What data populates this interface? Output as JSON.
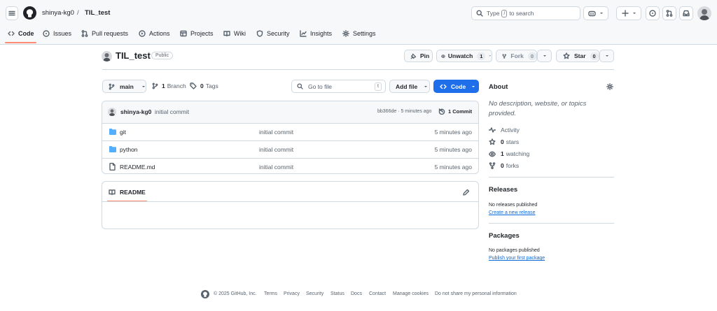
{
  "header": {
    "owner": "shinya-kg0",
    "separator": "/",
    "repo": "TIL_test",
    "search_prefix": "Type",
    "search_key": "/",
    "search_suffix": "to search",
    "tabs": [
      {
        "label": "Code",
        "icon": "code-icon",
        "selected": true
      },
      {
        "label": "Issues",
        "icon": "issue-icon"
      },
      {
        "label": "Pull requests",
        "icon": "pull-request-icon"
      },
      {
        "label": "Actions",
        "icon": "play-icon"
      },
      {
        "label": "Projects",
        "icon": "table-icon"
      },
      {
        "label": "Wiki",
        "icon": "book-icon"
      },
      {
        "label": "Security",
        "icon": "shield-icon"
      },
      {
        "label": "Insights",
        "icon": "graph-icon"
      },
      {
        "label": "Settings",
        "icon": "gear-icon"
      }
    ]
  },
  "repo": {
    "name": "TIL_test",
    "visibility": "Public",
    "pin_label": "Pin",
    "unwatch_label": "Unwatch",
    "watch_count": "1",
    "fork_label": "Fork",
    "fork_count": "0",
    "star_label": "Star",
    "star_count": "0"
  },
  "toolbar": {
    "branch": "main",
    "branch_count": "1",
    "branch_label": "Branch",
    "tag_count": "0",
    "tag_label": "Tags",
    "goto_placeholder": "Go to file",
    "goto_key": "t",
    "add_file_label": "Add file",
    "code_label": "Code"
  },
  "commit": {
    "author": "shinya-kg0",
    "message": "initial commit",
    "meta": "bb366de · 5 minutes ago",
    "count_label": "1 Commit"
  },
  "files": [
    {
      "name": "git",
      "type": "folder",
      "message": "initial commit",
      "date": "5 minutes ago"
    },
    {
      "name": "python",
      "type": "folder",
      "message": "initial commit",
      "date": "5 minutes ago"
    },
    {
      "name": "README.md",
      "type": "file",
      "message": "initial commit",
      "date": "5 minutes ago"
    }
  ],
  "readme": {
    "tab_label": "README"
  },
  "sidebar": {
    "about_title": "About",
    "description": "No description, website, or topics provided.",
    "activity_label": "Activity",
    "stars_count": "0",
    "stars_label": "stars",
    "watching_count": "1",
    "watching_label": "watching",
    "forks_count": "0",
    "forks_label": "forks",
    "releases_title": "Releases",
    "releases_empty": "No releases published",
    "releases_link": "Create a new release",
    "packages_title": "Packages",
    "packages_empty": "No packages published",
    "packages_link": "Publish your first package"
  },
  "footer": {
    "copyright": "© 2025 GitHub, Inc.",
    "links": [
      "Terms",
      "Privacy",
      "Security",
      "Status",
      "Docs",
      "Contact",
      "Manage cookies",
      "Do not share my personal information"
    ]
  },
  "colors": {
    "accent_blue": "#1f6feb",
    "link_blue": "#0969da",
    "tab_underline": "#fd8c73",
    "folder_blue": "#54aeff",
    "border": "#d1d9e0"
  }
}
